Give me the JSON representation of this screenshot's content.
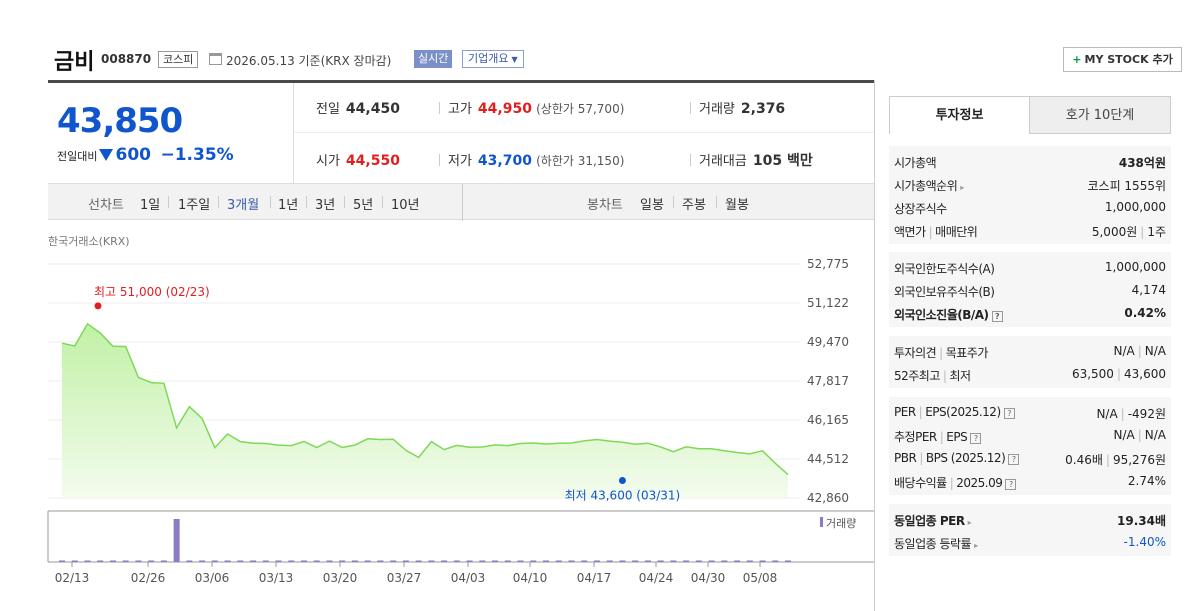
{
  "header": {
    "name": "금비",
    "code": "008870",
    "market": "코스피",
    "date_text": "2026.05.13 기준(KRX 장마감)",
    "realtime": "실시간",
    "corp_info": "기업개요",
    "mystock": "MY STOCK 추가"
  },
  "price": {
    "current": "43,850",
    "change_label": "전일대비",
    "change_value": "600",
    "change_pct": "−1.35%"
  },
  "quotes": {
    "prev_label": "전일",
    "prev": "44,450",
    "high_label": "고가",
    "high": "44,950",
    "upper": "(상한가 57,700)",
    "volume_label": "거래량",
    "volume": "2,376",
    "open_label": "시가",
    "open": "44,550",
    "low_label": "저가",
    "low": "43,700",
    "lower": "(하한가 31,150)",
    "amount_label": "거래대금",
    "amount": "105 백만"
  },
  "chart_controls": {
    "line_label": "선차트",
    "line_options": [
      "1일",
      "1주일",
      "3개월",
      "1년",
      "3년",
      "5년",
      "10년"
    ],
    "selected": "3개월",
    "candle_label": "봉차트",
    "candle_options": [
      "일봉",
      "주봉",
      "월봉"
    ]
  },
  "chart_source": "한국거래소(KRX)",
  "chart_data": {
    "type": "area",
    "x_tick_labels": [
      "02/13",
      "02/26",
      "03/06",
      "03/13",
      "03/20",
      "03/27",
      "04/03",
      "04/10",
      "04/17",
      "04/24",
      "04/30",
      "05/08"
    ],
    "y_tick_labels": [
      "52,775",
      "51,122",
      "49,470",
      "47,817",
      "46,165",
      "44,512",
      "42,860"
    ],
    "ylim": [
      42860,
      52775
    ],
    "high_label": "최고 51,000 (02/23)",
    "low_label": "최저 43,600 (03/31)",
    "high_value": 51000,
    "low_value": 43600,
    "high_index": 3.5,
    "low_index": 44,
    "volume_label": "거래량",
    "series": [
      {
        "values": [
          49420,
          49300,
          50240,
          49850,
          49290,
          49280,
          47970,
          47750,
          47720,
          45830,
          46730,
          46230,
          44990,
          45570,
          45250,
          45180,
          45170,
          45100,
          45080,
          45260,
          45000,
          45270,
          45000,
          45100,
          45370,
          45340,
          45350,
          44880,
          44580,
          45250,
          44910,
          45090,
          45010,
          45020,
          45110,
          45080,
          45170,
          45190,
          45150,
          45180,
          45190,
          45280,
          45340,
          45270,
          45220,
          45140,
          45180,
          45020,
          44820,
          45030,
          44950,
          44950,
          44860,
          44790,
          44730,
          44860,
          44330,
          43850
        ]
      }
    ],
    "volume": [
      1.5,
      1.5,
      1.5,
      1.5,
      1.5,
      1.5,
      1.5,
      1.5,
      1.5,
      42,
      1.5,
      1.5,
      1.5,
      1.5,
      1.5,
      1.5,
      1.5,
      1.5,
      1.5,
      1.5,
      1.5,
      1.5,
      1.5,
      1.5,
      1.5,
      1.5,
      1.5,
      1.5,
      1.5,
      1.5,
      1.5,
      1.5,
      1.5,
      1.5,
      1.5,
      1.5,
      1.5,
      1.5,
      1.5,
      1.5,
      1.5,
      1.5,
      1.5,
      1.5,
      1.5,
      1.5,
      1.5,
      1.5,
      1.5,
      1.5,
      1.5,
      1.5,
      1.5,
      1.5,
      1.5,
      1.5,
      1.5,
      1.5
    ]
  },
  "right_panel": {
    "tab_info": "투자정보",
    "tab_hoga": "호가 10단계",
    "g1": [
      {
        "k": "시가총액",
        "v": "438억원"
      },
      {
        "k": "시가총액순위",
        "v": "코스피 1555위"
      },
      {
        "k": "상장주식수",
        "v": "1,000,000"
      },
      {
        "k": "액면가",
        "k2": "매매단위",
        "v": "5,000원",
        "v2": "1주"
      }
    ],
    "g2": [
      {
        "k": "외국인한도주식수(A)",
        "v": "1,000,000"
      },
      {
        "k": "외국인보유주식수(B)",
        "v": "4,174"
      },
      {
        "k": "외국인소진율(B/A)",
        "v": "0.42%"
      }
    ],
    "g3": [
      {
        "k": "투자의견",
        "k2": "목표주가",
        "v": "N/A",
        "v2": "N/A"
      },
      {
        "k": "52주최고",
        "k2": "최저",
        "v": "63,500",
        "v2": "43,600"
      }
    ],
    "g4": [
      {
        "k": "PER",
        "k2": "EPS(2025.12)",
        "v": "N/A",
        "v2": "-492원"
      },
      {
        "k": "추정PER",
        "k2": "EPS",
        "v": "N/A",
        "v2": "N/A"
      },
      {
        "k": "PBR",
        "k2": "BPS (2025.12)",
        "v": "0.46배",
        "v2": "95,276원"
      },
      {
        "k": "배당수익률",
        "k2": "2025.09",
        "v": "2.74%"
      }
    ],
    "g5": [
      {
        "k": "동일업종 PER",
        "v": "19.34배"
      },
      {
        "k": "동일업종 등락률",
        "v": "-1.40%"
      }
    ],
    "colors": {
      "up": "#e02020",
      "down": "#1155cc",
      "area": "#c8f0b0",
      "line": "#7ed957"
    }
  }
}
